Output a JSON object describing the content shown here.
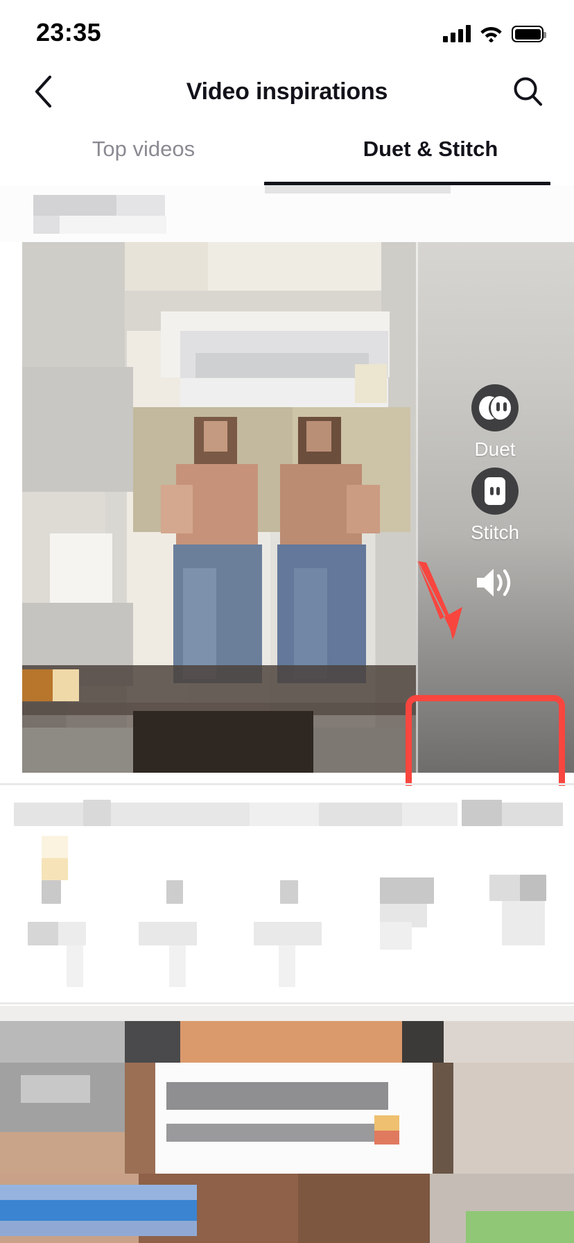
{
  "status_bar": {
    "time": "23:35",
    "icons": [
      "cellular-signal-icon",
      "wifi-icon",
      "battery-icon"
    ],
    "battery_level": "85"
  },
  "nav_bar": {
    "back_icon": "chevron-left-icon",
    "title": "Video inspirations",
    "search_icon": "search-icon"
  },
  "tabs": {
    "items": [
      {
        "label": "Top videos",
        "selected": false
      },
      {
        "label": "Duet & Stitch",
        "selected": true
      }
    ],
    "active_index": 1,
    "indicator_color": "#12131a"
  },
  "video_actions": [
    {
      "label": "Duet",
      "icon": "duet-icon",
      "highlighted": true
    },
    {
      "label": "Stitch",
      "icon": "stitch-icon",
      "highlighted": false
    },
    {
      "label": "",
      "icon": "speaker-volume-icon",
      "highlighted": false
    }
  ],
  "annotation": {
    "shape": "rounded-rectangle-highlight",
    "arrow": "down-arrow",
    "color": "#f8463f",
    "target": "Duet"
  },
  "feed": {
    "items": [
      {
        "type": "video-card",
        "content_blurred": true
      },
      {
        "type": "info-row",
        "content_blurred": true
      },
      {
        "type": "video-card",
        "content_blurred": true
      }
    ]
  },
  "colors": {
    "accent_red": "#f8463f",
    "text_primary": "#12131a",
    "text_secondary": "#8a8b92",
    "background": "#ffffff",
    "action_circle": "#3f3f41"
  }
}
